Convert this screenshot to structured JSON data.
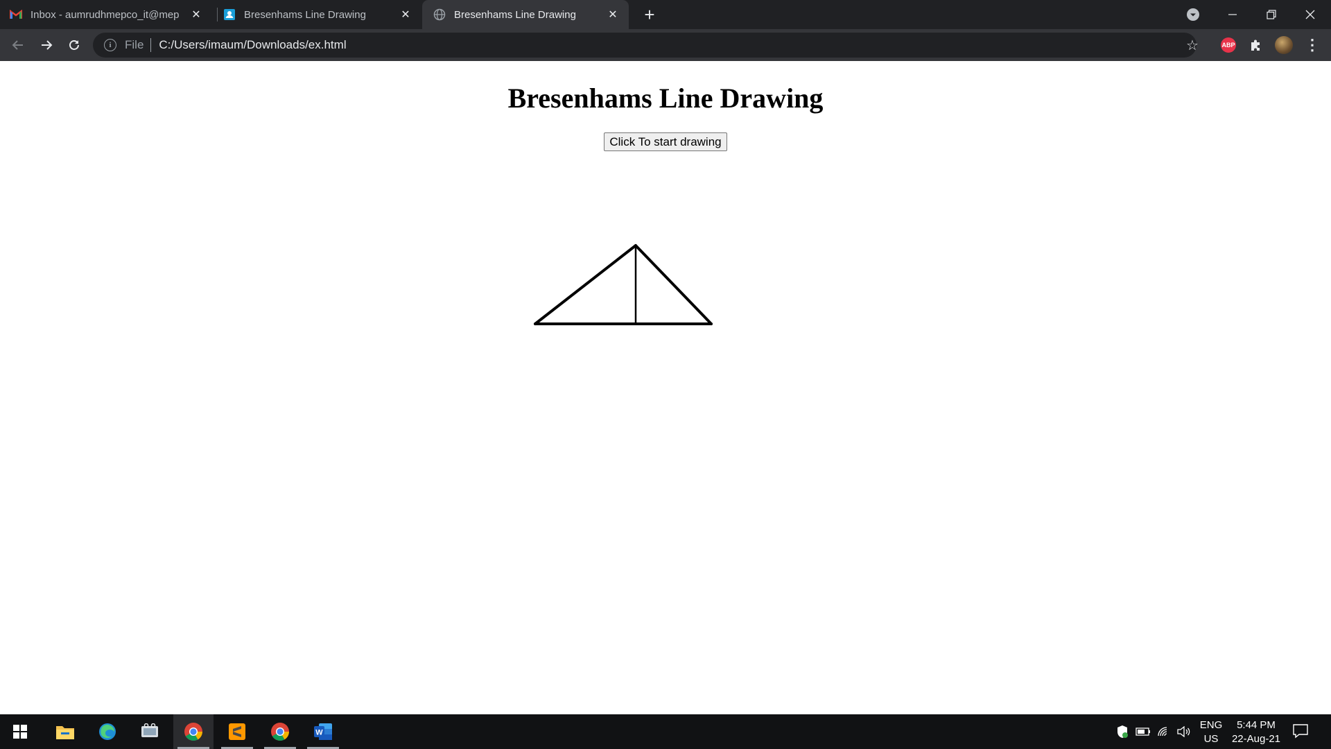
{
  "browser": {
    "tabs": [
      {
        "title": "Inbox - aumrudhmepco_it@mep",
        "icon": "gmail-icon",
        "active": false
      },
      {
        "title": "Bresenhams Line Drawing",
        "icon": "contacts-icon",
        "active": false
      },
      {
        "title": "Bresenhams Line Drawing",
        "icon": "globe-icon",
        "active": true
      }
    ],
    "address_scheme": "File",
    "address_url": "C:/Users/imaum/Downloads/ex.html"
  },
  "page": {
    "heading": "Bresenhams Line Drawing",
    "button_label": "Click To start drawing"
  },
  "taskbar": {
    "apps": [
      "start-icon",
      "file-explorer-icon",
      "edge-icon",
      "snipping-tool-icon",
      "chrome-icon",
      "sublime-text-icon",
      "chrome-icon",
      "word-icon"
    ],
    "language": [
      "ENG",
      "US"
    ],
    "time": "5:44 PM",
    "date": "22-Aug-21"
  },
  "colors": {
    "chrome_dark": "#202124",
    "chrome_toolbar": "#35363a",
    "taskbar": "#111214",
    "abp_red": "#e8334a"
  }
}
